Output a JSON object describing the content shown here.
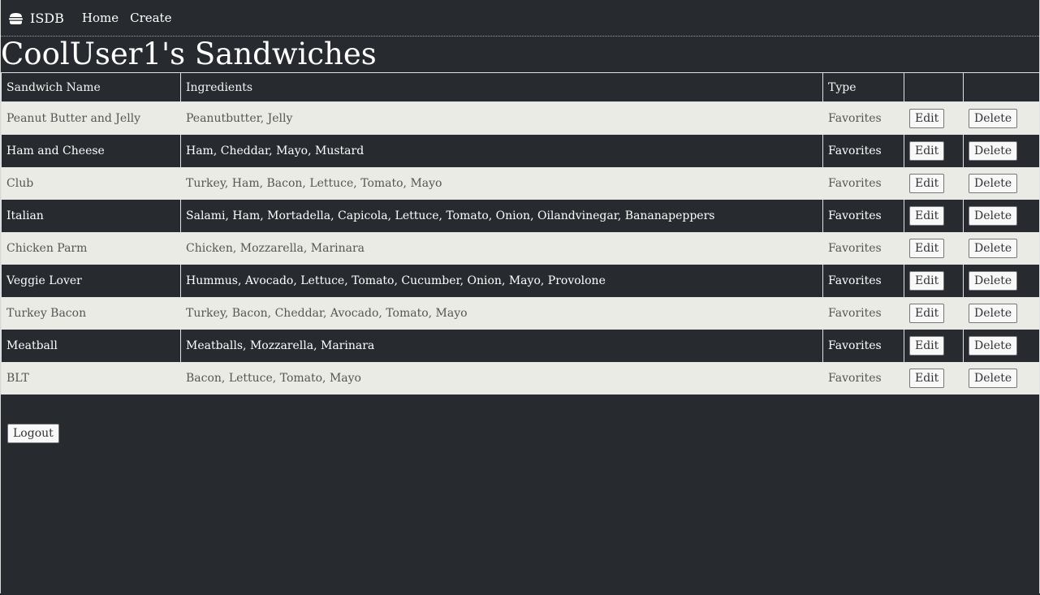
{
  "nav": {
    "brand": "ISDB",
    "links": [
      "Home",
      "Create"
    ]
  },
  "page_title": "CoolUser1's Sandwiches",
  "table": {
    "headers": [
      "Sandwich Name",
      "Ingredients",
      "Type",
      "",
      ""
    ],
    "rows": [
      {
        "name": "Peanut Butter and Jelly",
        "ingredients": "Peanutbutter, Jelly",
        "type": "Favorites",
        "edit": "Edit",
        "delete": "Delete"
      },
      {
        "name": "Ham and Cheese",
        "ingredients": "Ham, Cheddar, Mayo, Mustard",
        "type": "Favorites",
        "edit": "Edit",
        "delete": "Delete"
      },
      {
        "name": "Club",
        "ingredients": "Turkey, Ham, Bacon, Lettuce, Tomato, Mayo",
        "type": "Favorites",
        "edit": "Edit",
        "delete": "Delete"
      },
      {
        "name": "Italian",
        "ingredients": "Salami, Ham, Mortadella, Capicola, Lettuce, Tomato, Onion, Oilandvinegar, Bananapeppers",
        "type": "Favorites",
        "edit": "Edit",
        "delete": "Delete"
      },
      {
        "name": "Chicken Parm",
        "ingredients": "Chicken, Mozzarella, Marinara",
        "type": "Favorites",
        "edit": "Edit",
        "delete": "Delete"
      },
      {
        "name": "Veggie Lover",
        "ingredients": "Hummus, Avocado, Lettuce, Tomato, Cucumber, Onion, Mayo, Provolone",
        "type": "Favorites",
        "edit": "Edit",
        "delete": "Delete"
      },
      {
        "name": "Turkey Bacon",
        "ingredients": "Turkey, Bacon, Cheddar, Avocado, Tomato, Mayo",
        "type": "Favorites",
        "edit": "Edit",
        "delete": "Delete"
      },
      {
        "name": "Meatball",
        "ingredients": "Meatballs, Mozzarella, Marinara",
        "type": "Favorites",
        "edit": "Edit",
        "delete": "Delete"
      },
      {
        "name": "BLT",
        "ingredients": "Bacon, Lettuce, Tomato, Mayo",
        "type": "Favorites",
        "edit": "Edit",
        "delete": "Delete"
      }
    ]
  },
  "logout_label": "Logout",
  "colors": {
    "background": "#272b30",
    "light_row": "#ebebe5",
    "text_light": "#ffffff"
  }
}
